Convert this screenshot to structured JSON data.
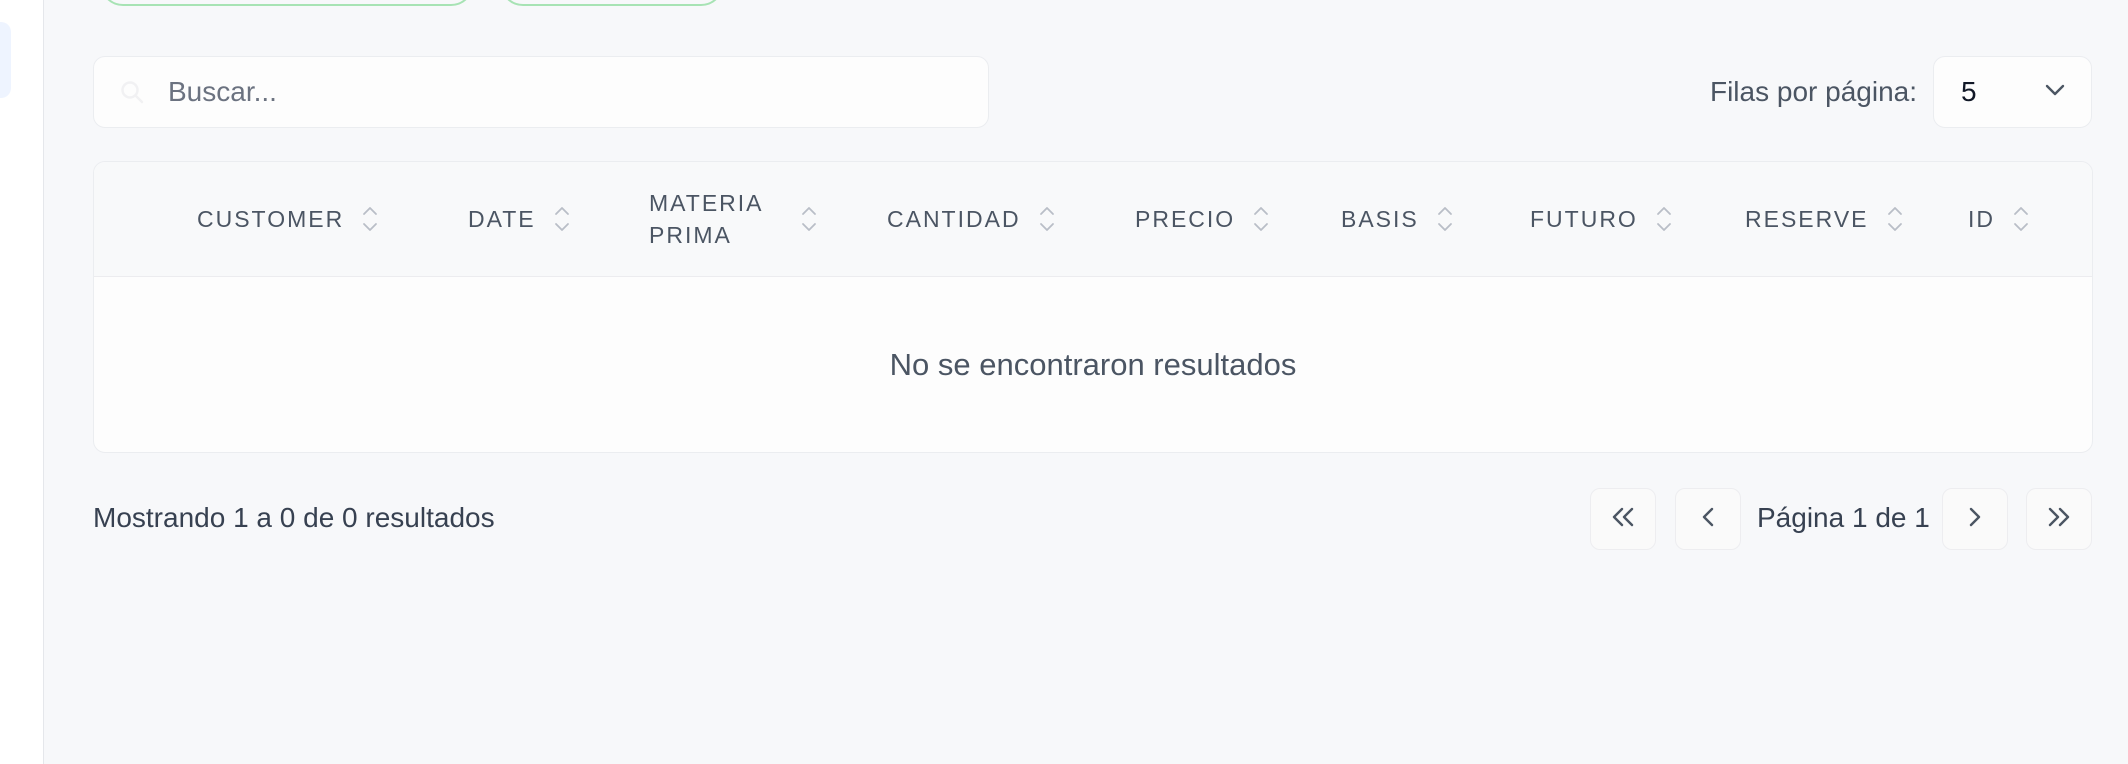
{
  "search": {
    "placeholder": "Buscar..."
  },
  "rows_per_page": {
    "label": "Filas por página:",
    "value": "5"
  },
  "table": {
    "columns": [
      {
        "label": "CUSTOMER"
      },
      {
        "label": "DATE"
      },
      {
        "label": "MATERIA PRIMA"
      },
      {
        "label": "CANTIDAD"
      },
      {
        "label": "PRECIO"
      },
      {
        "label": "BASIS"
      },
      {
        "label": "FUTURO"
      },
      {
        "label": "RESERVE"
      },
      {
        "label": "ID"
      }
    ],
    "empty_message": "No se encontraron resultados"
  },
  "footer": {
    "showing": "Mostrando 1 a 0 de 0 resultados"
  },
  "pagination": {
    "page_info": "Página 1 de 1"
  },
  "icons": {
    "search": "search-icon",
    "chevron_down": "chevron-down-icon",
    "sort": "sort-icon",
    "first": "double-chevron-left-icon",
    "prev": "chevron-left-icon",
    "next": "chevron-right-icon",
    "last": "double-chevron-right-icon"
  },
  "colors": {
    "page_bg": "#f7f8fa",
    "pill_border": "#a7e3b4",
    "text": "#374151"
  }
}
